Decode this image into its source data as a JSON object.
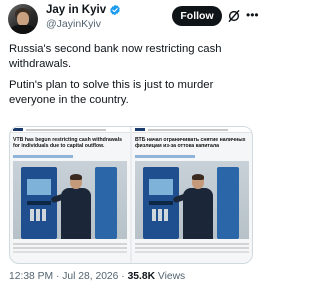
{
  "author": {
    "name": "Jay in Kyiv",
    "handle": "@JayinKyiv",
    "verified": true,
    "follow_label": "Follow",
    "accent_color": "#1d9bf0"
  },
  "icons": {
    "verified": "verified-badge-icon",
    "grok": "grok-icon",
    "more": "more-options-icon"
  },
  "post": {
    "paragraph_1": "Russia's second bank now restricting cash withdrawals.",
    "paragraph_2": "Putin's plan to solve this is just to murder everyone in the country."
  },
  "media": {
    "left_headline": "VTB has begun restricting cash withdrawals for individuals due to capital outflow.",
    "right_headline": "ВТБ начал ограничивать снятие наличных физлицам из-за оттока капитала"
  },
  "meta": {
    "time": "12:38 PM",
    "date": "Jul 28, 2026",
    "separator": "·",
    "views_count": "35.8K",
    "views_label": "Views"
  }
}
